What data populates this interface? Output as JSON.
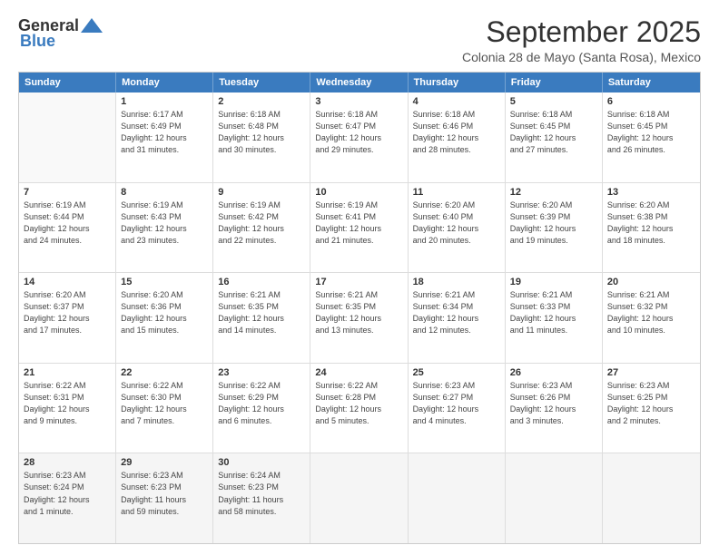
{
  "logo": {
    "general": "General",
    "blue": "Blue"
  },
  "title": "September 2025",
  "subtitle": "Colonia 28 de Mayo (Santa Rosa), Mexico",
  "weekdays": [
    "Sunday",
    "Monday",
    "Tuesday",
    "Wednesday",
    "Thursday",
    "Friday",
    "Saturday"
  ],
  "rows": [
    [
      {
        "day": "",
        "info": ""
      },
      {
        "day": "1",
        "info": "Sunrise: 6:17 AM\nSunset: 6:49 PM\nDaylight: 12 hours\nand 31 minutes."
      },
      {
        "day": "2",
        "info": "Sunrise: 6:18 AM\nSunset: 6:48 PM\nDaylight: 12 hours\nand 30 minutes."
      },
      {
        "day": "3",
        "info": "Sunrise: 6:18 AM\nSunset: 6:47 PM\nDaylight: 12 hours\nand 29 minutes."
      },
      {
        "day": "4",
        "info": "Sunrise: 6:18 AM\nSunset: 6:46 PM\nDaylight: 12 hours\nand 28 minutes."
      },
      {
        "day": "5",
        "info": "Sunrise: 6:18 AM\nSunset: 6:45 PM\nDaylight: 12 hours\nand 27 minutes."
      },
      {
        "day": "6",
        "info": "Sunrise: 6:18 AM\nSunset: 6:45 PM\nDaylight: 12 hours\nand 26 minutes."
      }
    ],
    [
      {
        "day": "7",
        "info": "Sunrise: 6:19 AM\nSunset: 6:44 PM\nDaylight: 12 hours\nand 24 minutes."
      },
      {
        "day": "8",
        "info": "Sunrise: 6:19 AM\nSunset: 6:43 PM\nDaylight: 12 hours\nand 23 minutes."
      },
      {
        "day": "9",
        "info": "Sunrise: 6:19 AM\nSunset: 6:42 PM\nDaylight: 12 hours\nand 22 minutes."
      },
      {
        "day": "10",
        "info": "Sunrise: 6:19 AM\nSunset: 6:41 PM\nDaylight: 12 hours\nand 21 minutes."
      },
      {
        "day": "11",
        "info": "Sunrise: 6:20 AM\nSunset: 6:40 PM\nDaylight: 12 hours\nand 20 minutes."
      },
      {
        "day": "12",
        "info": "Sunrise: 6:20 AM\nSunset: 6:39 PM\nDaylight: 12 hours\nand 19 minutes."
      },
      {
        "day": "13",
        "info": "Sunrise: 6:20 AM\nSunset: 6:38 PM\nDaylight: 12 hours\nand 18 minutes."
      }
    ],
    [
      {
        "day": "14",
        "info": "Sunrise: 6:20 AM\nSunset: 6:37 PM\nDaylight: 12 hours\nand 17 minutes."
      },
      {
        "day": "15",
        "info": "Sunrise: 6:20 AM\nSunset: 6:36 PM\nDaylight: 12 hours\nand 15 minutes."
      },
      {
        "day": "16",
        "info": "Sunrise: 6:21 AM\nSunset: 6:35 PM\nDaylight: 12 hours\nand 14 minutes."
      },
      {
        "day": "17",
        "info": "Sunrise: 6:21 AM\nSunset: 6:35 PM\nDaylight: 12 hours\nand 13 minutes."
      },
      {
        "day": "18",
        "info": "Sunrise: 6:21 AM\nSunset: 6:34 PM\nDaylight: 12 hours\nand 12 minutes."
      },
      {
        "day": "19",
        "info": "Sunrise: 6:21 AM\nSunset: 6:33 PM\nDaylight: 12 hours\nand 11 minutes."
      },
      {
        "day": "20",
        "info": "Sunrise: 6:21 AM\nSunset: 6:32 PM\nDaylight: 12 hours\nand 10 minutes."
      }
    ],
    [
      {
        "day": "21",
        "info": "Sunrise: 6:22 AM\nSunset: 6:31 PM\nDaylight: 12 hours\nand 9 minutes."
      },
      {
        "day": "22",
        "info": "Sunrise: 6:22 AM\nSunset: 6:30 PM\nDaylight: 12 hours\nand 7 minutes."
      },
      {
        "day": "23",
        "info": "Sunrise: 6:22 AM\nSunset: 6:29 PM\nDaylight: 12 hours\nand 6 minutes."
      },
      {
        "day": "24",
        "info": "Sunrise: 6:22 AM\nSunset: 6:28 PM\nDaylight: 12 hours\nand 5 minutes."
      },
      {
        "day": "25",
        "info": "Sunrise: 6:23 AM\nSunset: 6:27 PM\nDaylight: 12 hours\nand 4 minutes."
      },
      {
        "day": "26",
        "info": "Sunrise: 6:23 AM\nSunset: 6:26 PM\nDaylight: 12 hours\nand 3 minutes."
      },
      {
        "day": "27",
        "info": "Sunrise: 6:23 AM\nSunset: 6:25 PM\nDaylight: 12 hours\nand 2 minutes."
      }
    ],
    [
      {
        "day": "28",
        "info": "Sunrise: 6:23 AM\nSunset: 6:24 PM\nDaylight: 12 hours\nand 1 minute."
      },
      {
        "day": "29",
        "info": "Sunrise: 6:23 AM\nSunset: 6:23 PM\nDaylight: 11 hours\nand 59 minutes."
      },
      {
        "day": "30",
        "info": "Sunrise: 6:24 AM\nSunset: 6:23 PM\nDaylight: 11 hours\nand 58 minutes."
      },
      {
        "day": "",
        "info": ""
      },
      {
        "day": "",
        "info": ""
      },
      {
        "day": "",
        "info": ""
      },
      {
        "day": "",
        "info": ""
      }
    ]
  ]
}
